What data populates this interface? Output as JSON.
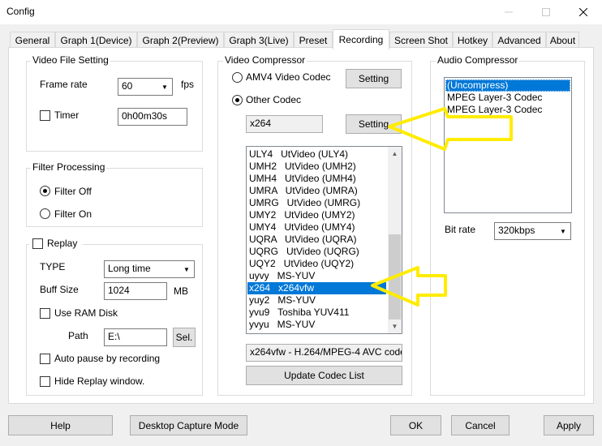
{
  "window": {
    "title": "Config",
    "minimize_icon": "minimize-icon",
    "maximize_icon": "maximize-icon",
    "close_icon": "close-icon"
  },
  "tabs": [
    {
      "label": "General"
    },
    {
      "label": "Graph 1(Device)"
    },
    {
      "label": "Graph 2(Preview)"
    },
    {
      "label": "Graph 3(Live)"
    },
    {
      "label": "Preset"
    },
    {
      "label": "Recording"
    },
    {
      "label": "Screen Shot"
    },
    {
      "label": "Hotkey"
    },
    {
      "label": "Advanced"
    },
    {
      "label": "About"
    }
  ],
  "active_tab": "Recording",
  "video_file": {
    "group_label": "Video File Setting",
    "frame_rate_label": "Frame rate",
    "frame_rate_value": "60",
    "fps_label": "fps",
    "timer_label": "Timer",
    "timer_checked": false,
    "timer_value": "0h00m30s"
  },
  "filter": {
    "group_label": "Filter Processing",
    "filter_off_label": "Filter Off",
    "filter_on_label": "Filter On",
    "selected": "Filter Off"
  },
  "replay": {
    "label": "Replay",
    "checked": false,
    "type_label": "TYPE",
    "type_value": "Long time",
    "buff_size_label": "Buff Size",
    "buff_size_value": "1024",
    "buff_unit": "MB",
    "use_ram_disk_label": "Use RAM Disk",
    "path_label": "Path",
    "path_value": "E:\\",
    "sel_button": "Sel.",
    "auto_pause_label": "Auto pause by recording",
    "hide_replay_label": "Hide Replay window."
  },
  "video_compressor": {
    "group_label": "Video Compressor",
    "amv4_label": "AMV4 Video Codec",
    "other_codec_label": "Other Codec",
    "selected": "Other Codec",
    "setting_button_1": "Setting",
    "setting_button_2": "Setting",
    "codec_field_value": "x264",
    "codec_list": [
      "ULY4   UtVideo (ULY4)",
      "UMH2   UtVideo (UMH2)",
      "UMH4   UtVideo (UMH4)",
      "UMRA   UtVideo (UMRA)",
      "UMRG   UtVideo (UMRG)",
      "UMY2   UtVideo (UMY2)",
      "UMY4   UtVideo (UMY4)",
      "UQRA   UtVideo (UQRA)",
      "UQRG   UtVideo (UQRG)",
      "UQY2   UtVideo (UQY2)",
      "uyvy   MS-YUV",
      "x264   x264vfw",
      "yuy2   MS-YUV",
      "yvu9   Toshiba YUV411",
      "yvyu   MS-YUV"
    ],
    "selected_codec": "x264   x264vfw",
    "codec_description": "x264vfw - H.264/MPEG-4 AVC code",
    "update_button": "Update Codec List"
  },
  "audio_compressor": {
    "group_label": "Audio Compressor",
    "list": [
      "(Uncompress)",
      "MPEG Layer-3 Codec",
      "MPEG Layer-3 Codec"
    ],
    "selected": "(Uncompress)",
    "bit_rate_label": "Bit rate",
    "bit_rate_value": "320kbps"
  },
  "footer": {
    "help": "Help",
    "desktop_capture": "Desktop Capture Mode",
    "ok": "OK",
    "cancel": "Cancel",
    "apply": "Apply"
  },
  "colors": {
    "selection": "#0078d7",
    "annotation_arrow": "#ffec00"
  }
}
